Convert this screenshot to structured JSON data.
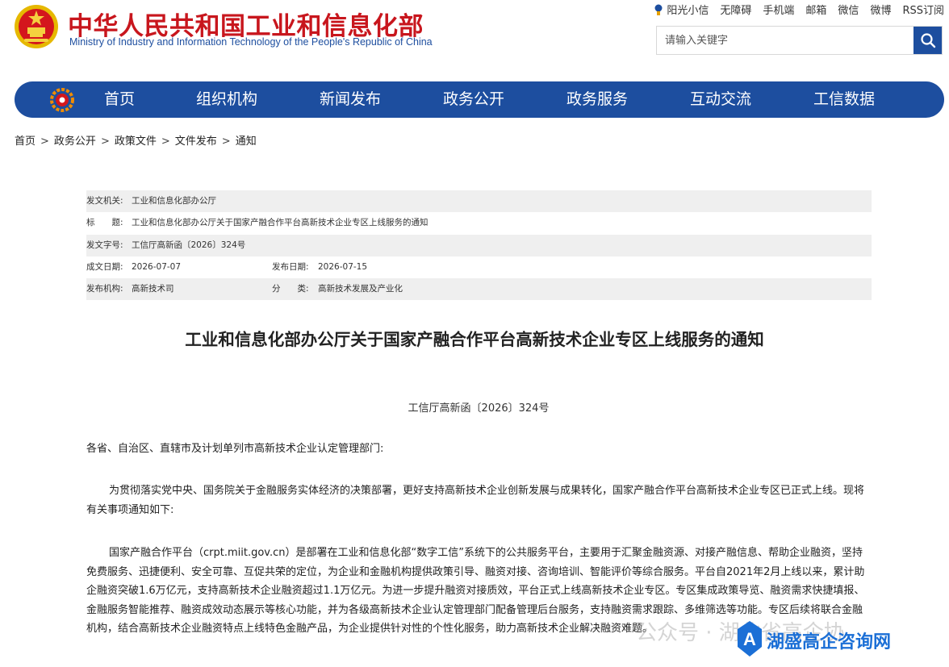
{
  "header": {
    "title_cn": "中华人民共和国工业和信息化部",
    "title_en": "Ministry of Industry and Information Technology of the People's Republic of China",
    "top_links": [
      "阳光小信",
      "无障碍",
      "手机端",
      "邮箱",
      "微信",
      "微博",
      "RSS订阅"
    ],
    "search_placeholder": "请输入关键字"
  },
  "nav": {
    "items": [
      "首页",
      "组织机构",
      "新闻发布",
      "政务公开",
      "政务服务",
      "互动交流",
      "工信数据"
    ]
  },
  "breadcrumb": [
    "首页",
    "政务公开",
    "政策文件",
    "文件发布",
    "通知"
  ],
  "info": {
    "issuer_label": "发文机关:",
    "issuer": "工业和信息化部办公厅",
    "title_label": "标　　题:",
    "title": "工业和信息化部办公厅关于国家产融合作平台高新技术企业专区上线服务的通知",
    "docno_label": "发文字号:",
    "docno": "工信厅高新函〔2026〕324号",
    "created_label": "成文日期:",
    "created": "2026-07-07",
    "published_label": "发布日期:",
    "published": "2026-07-15",
    "publisher_label": "发布机构:",
    "publisher": "高新技术司",
    "category_label": "分　　类:",
    "category": "高新技术发展及产业化"
  },
  "article": {
    "title": "工业和信息化部办公厅关于国家产融合作平台高新技术企业专区上线服务的通知",
    "doc_no": "工信厅高新函〔2026〕324号",
    "addressee": "各省、自治区、直辖市及计划单列市高新技术企业认定管理部门:",
    "para1": "为贯彻落实党中央、国务院关于金融服务实体经济的决策部署，更好支持高新技术企业创新发展与成果转化，国家产融合作平台高新技术企业专区已正式上线。现将有关事项通知如下:",
    "para2": "国家产融合作平台（crpt.miit.gov.cn）是部署在工业和信息化部“数字工信”系统下的公共服务平台，主要用于汇聚金融资源、对接产融信息、帮助企业融资，坚持免费服务、迅捷便利、安全可靠、互促共荣的定位，为企业和金融机构提供政策引导、融资对接、咨询培训、智能评价等综合服务。平台自2021年2月上线以来，累计助企融资突破1.6万亿元，支持高新技术企业融资超过1.1万亿元。为进一步提升融资对接质效，平台正式上线高新技术企业专区。专区集成政策导览、融资需求快捷填报、金融服务智能推荐、融资成效动态展示等核心功能，并为各级高新技术企业认定管理部门配备管理后台服务，支持融资需求跟踪、多维筛选等功能。专区后续将联合金融机构，结合高新技术企业融资特点上线特色金融产品，为企业提供针对性的个性化服务，助力高新技术企业解决融资难题。"
  },
  "watermark": {
    "text": "公众号 · 湖北省高企协",
    "brand": "湖盛高企咨询网"
  }
}
